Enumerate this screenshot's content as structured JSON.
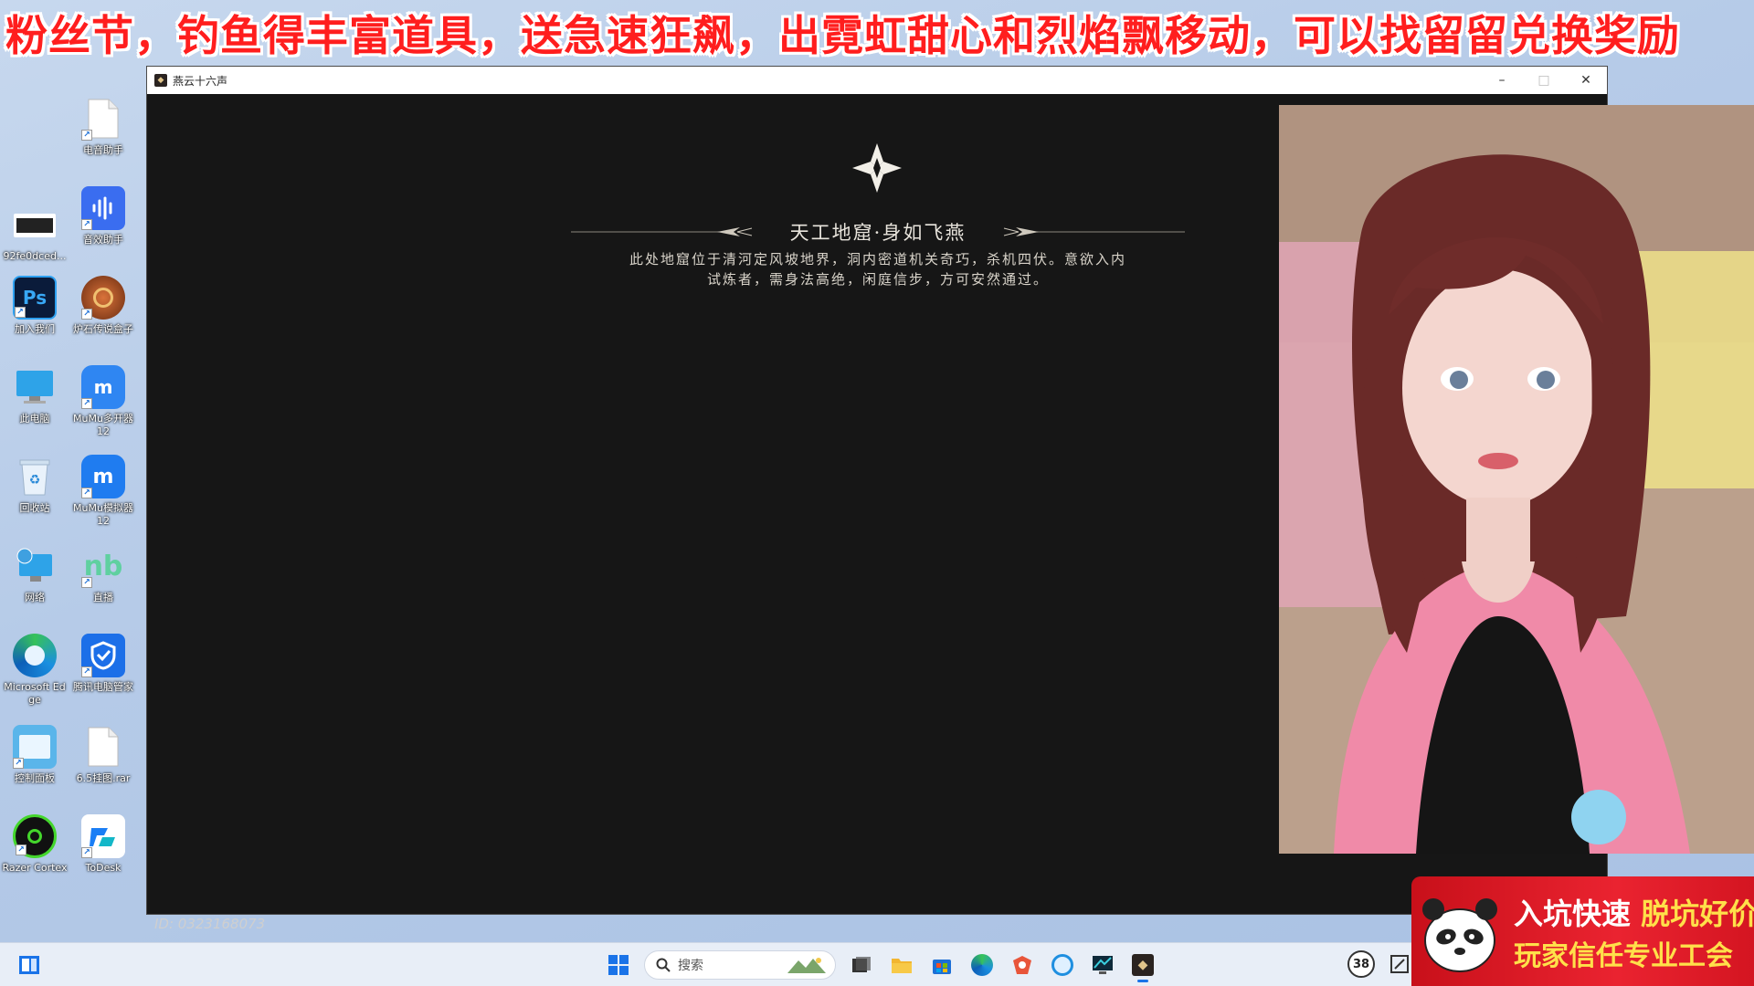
{
  "banner": {
    "text": "粉丝节，钓鱼得丰富道具，送急速狂飙，出霓虹甜心和烈焰飘移动，可以找留留兑换奖励",
    "color": "#ff1e1e"
  },
  "desktop": {
    "icons": [
      {
        "label": "电音助手",
        "icon": "file-icon"
      },
      {
        "label": "92fe0dced...",
        "icon": "image-thumb-icon"
      },
      {
        "label": "音效助手",
        "icon": "audio-wave-icon"
      },
      {
        "label": "加入我们",
        "icon": "photoshop-icon"
      },
      {
        "label": "炉石传说盒子",
        "icon": "hearthstone-box-icon"
      },
      {
        "label": "此电脑",
        "icon": "computer-icon"
      },
      {
        "label": "MuMu多开器12",
        "icon": "mumu-multi-icon"
      },
      {
        "label": "回收站",
        "icon": "recycle-bin-icon"
      },
      {
        "label": "MuMu模拟器12",
        "icon": "mumu-emulator-icon"
      },
      {
        "label": "网络",
        "icon": "network-icon"
      },
      {
        "label": "直播",
        "icon": "live-icon"
      },
      {
        "label": "Microsoft Edge",
        "icon": "edge-icon"
      },
      {
        "label": "腾讯电脑管家",
        "icon": "tencent-shield-icon"
      },
      {
        "label": "控制面板",
        "icon": "control-panel-icon"
      },
      {
        "label": "6.5挂图.rar",
        "icon": "file-icon"
      },
      {
        "label": "Razer Cortex",
        "icon": "razer-cortex-icon"
      },
      {
        "label": "ToDesk",
        "icon": "todesk-icon"
      }
    ]
  },
  "window": {
    "title": "燕云十六声",
    "minimize": "–",
    "maximize": "□",
    "close": "✕"
  },
  "game": {
    "heading": "天工地窟·身如飞燕",
    "desc_line1": "此处地窟位于清河定风坡地界，洞内密道机关奇巧，杀机四伏。意欲入内",
    "desc_line2": "试炼者，需身法高绝，闲庭信步，方可安然通过。",
    "id_text": "ID: 0323168073"
  },
  "promo": {
    "line1_a": "入坑快速",
    "line1_b": "脱坑好价",
    "line2": "玩家信任专业工会"
  },
  "taskbar": {
    "search_placeholder": "搜索",
    "notification_count": "38"
  }
}
